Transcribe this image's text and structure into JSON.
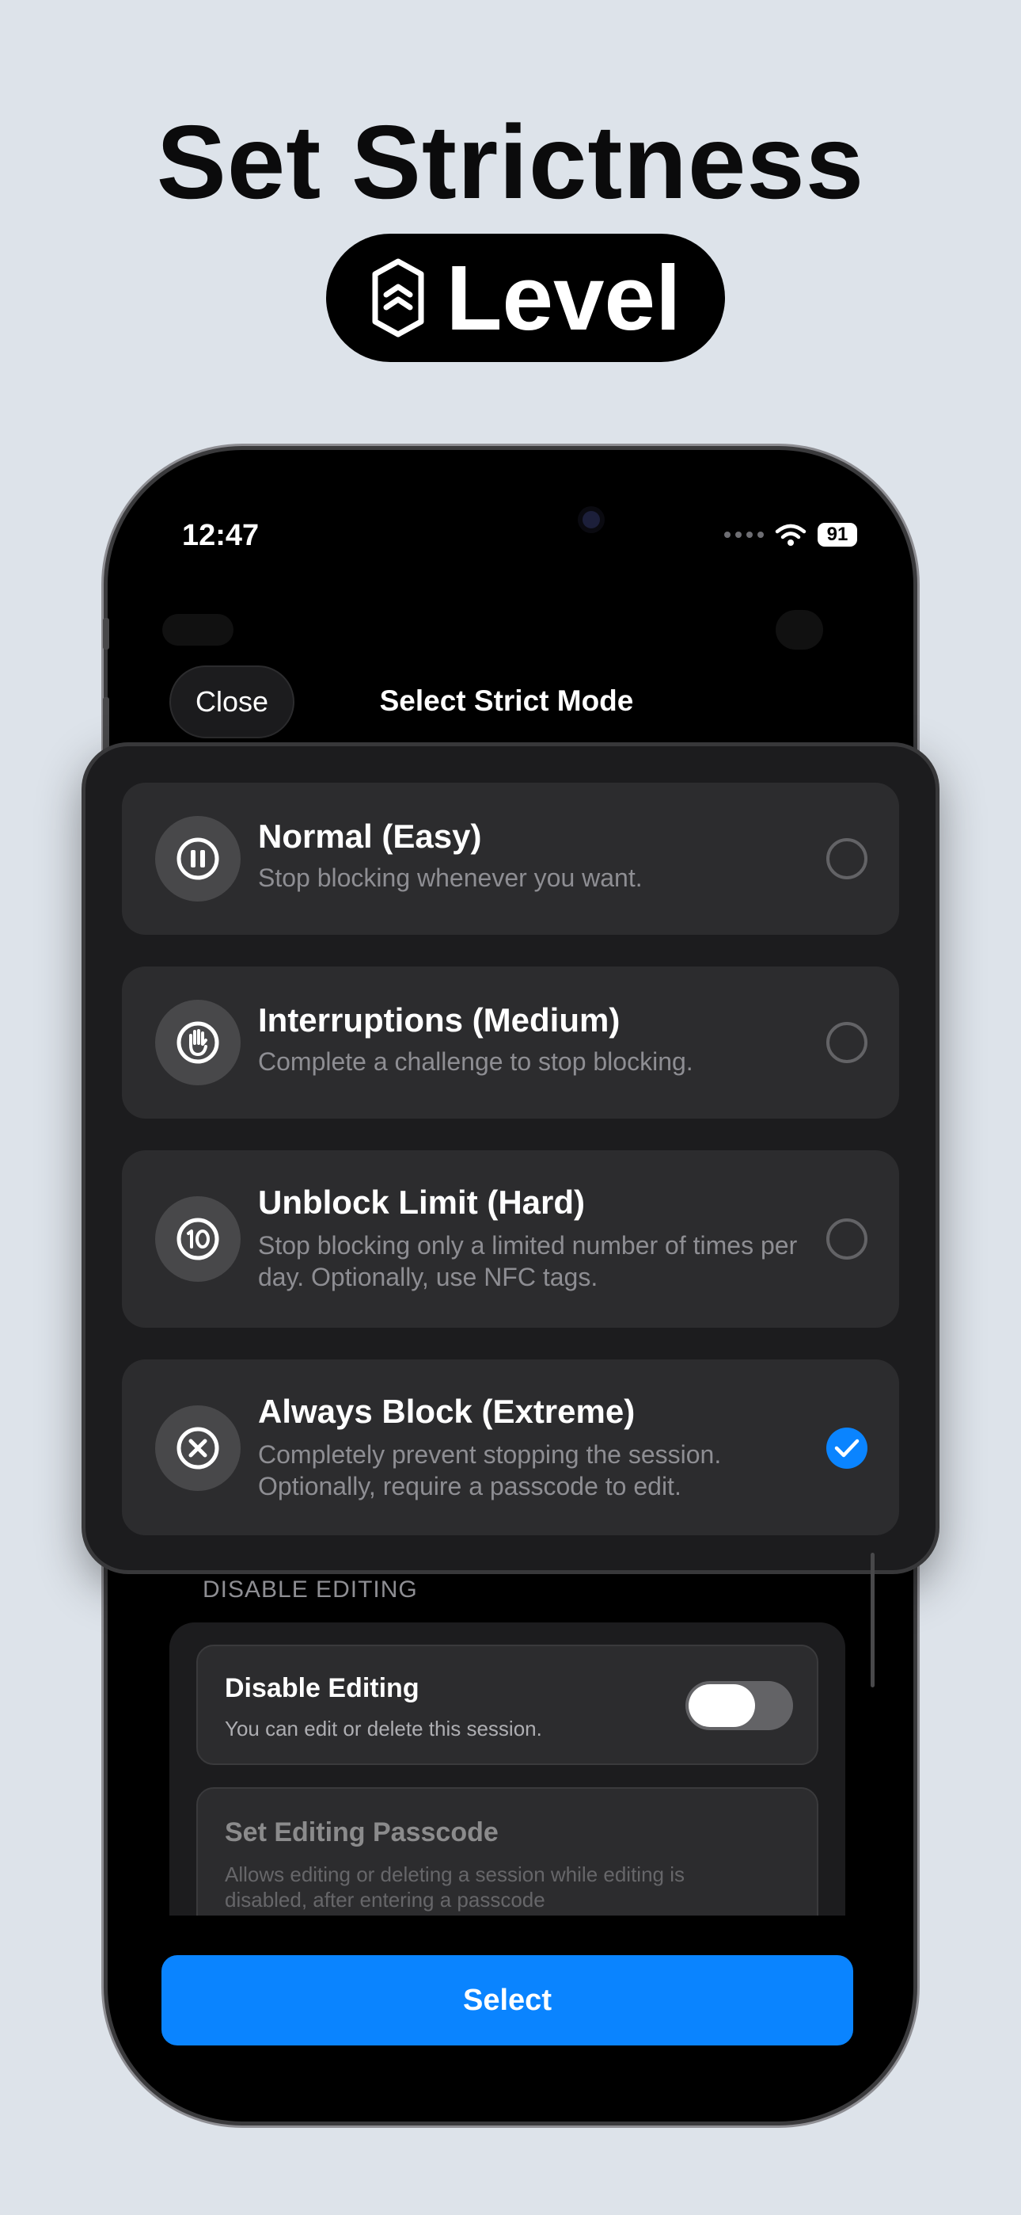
{
  "promo": {
    "headline": "Set Strictness",
    "pill_text": "Level",
    "pill_icon": "shield-chevron-icon"
  },
  "status_bar": {
    "time": "12:47",
    "battery": "91"
  },
  "sheet": {
    "close_label": "Close",
    "title": "Select Strict Mode"
  },
  "options": [
    {
      "title": "Normal (Easy)",
      "description": "Stop blocking whenever you want.",
      "icon": "pause-icon",
      "selected": false
    },
    {
      "title": "Interruptions (Medium)",
      "description": "Complete a challenge to stop blocking.",
      "icon": "hand-icon",
      "selected": false
    },
    {
      "title": "Unblock Limit (Hard)",
      "description": "Stop blocking only a limited number of times per day. Optionally, use NFC tags.",
      "icon": "ten-count-icon",
      "selected": false
    },
    {
      "title": "Always Block (Extreme)",
      "description": "Completely prevent stopping the session. Optionally, require a passcode to edit.",
      "icon": "x-circle-icon",
      "selected": true
    }
  ],
  "disable_editing": {
    "section_header": "DISABLE EDITING",
    "toggle_title": "Disable Editing",
    "toggle_subtitle": "You can edit or delete this session.",
    "toggle_on": false,
    "passcode_title": "Set Editing Passcode",
    "passcode_subtitle": "Allows editing or deleting a session while editing is disabled, after entering a passcode"
  },
  "footer": {
    "select_label": "Select"
  },
  "colors": {
    "accent": "#0a84ff",
    "background": "#dde3ea",
    "card": "#1c1c1e",
    "option": "#2c2c2e"
  }
}
